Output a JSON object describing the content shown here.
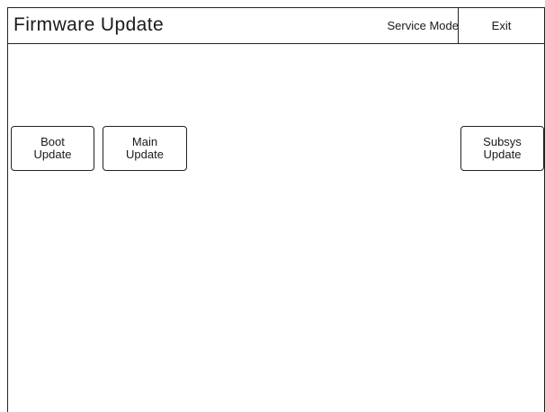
{
  "header": {
    "title": "Firmware Update",
    "mode": "Service Mode",
    "exit_label": "Exit"
  },
  "buttons": {
    "boot": {
      "line1": "Boot",
      "line2": "Update"
    },
    "main": {
      "line1": "Main",
      "line2": "Update"
    },
    "subsys": {
      "line1": "Subsys",
      "line2": "Update"
    }
  }
}
